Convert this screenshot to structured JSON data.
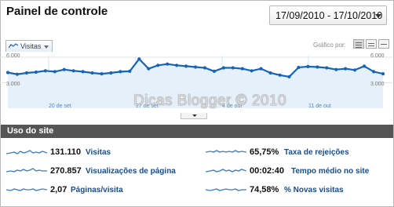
{
  "header": {
    "title": "Painel de controle",
    "date_range": "17/09/2010 - 17/10/2010"
  },
  "graph_controls": {
    "metric_selector": "Visitas",
    "graph_by_label": "Gráfico por:"
  },
  "chart_data": {
    "type": "area",
    "series": [
      {
        "name": "Visitas",
        "values": [
          4200,
          4000,
          4150,
          4250,
          4400,
          4300,
          4550,
          4400,
          4300,
          4150,
          4050,
          4150,
          4300,
          4350,
          5800,
          4650,
          5050,
          5200,
          5050,
          4950,
          4850,
          4750,
          4350,
          4750,
          4750,
          4650,
          4400,
          4650,
          4150,
          3900,
          3700,
          4800,
          4900,
          4850,
          4750,
          4550,
          4650,
          4500,
          4950,
          4300,
          4050
        ]
      }
    ],
    "x_tick_labels": [
      "20 de set",
      "27 de set",
      "4 de out",
      "11 de out"
    ],
    "y_tick_labels_left": [
      "6.000",
      "3.000"
    ],
    "y_tick_labels_right": [
      "6.000",
      "3.000"
    ],
    "ylim": [
      0,
      6000
    ],
    "color": "#1464b9"
  },
  "watermark": "Dicas Blogger © 2010",
  "site_usage": {
    "title": "Uso do site",
    "left": [
      {
        "value": "131.110",
        "label": "Visitas"
      },
      {
        "value": "270.857",
        "label": "Visualizações de página"
      },
      {
        "value": "2,07",
        "label": "Páginas/visita"
      }
    ],
    "right": [
      {
        "value": "65,75%",
        "label": "Taxa de rejeições"
      },
      {
        "value": "00:02:40",
        "label": "Tempo médio no site"
      },
      {
        "value": "74,58%",
        "label": "% Novas visitas"
      }
    ]
  }
}
